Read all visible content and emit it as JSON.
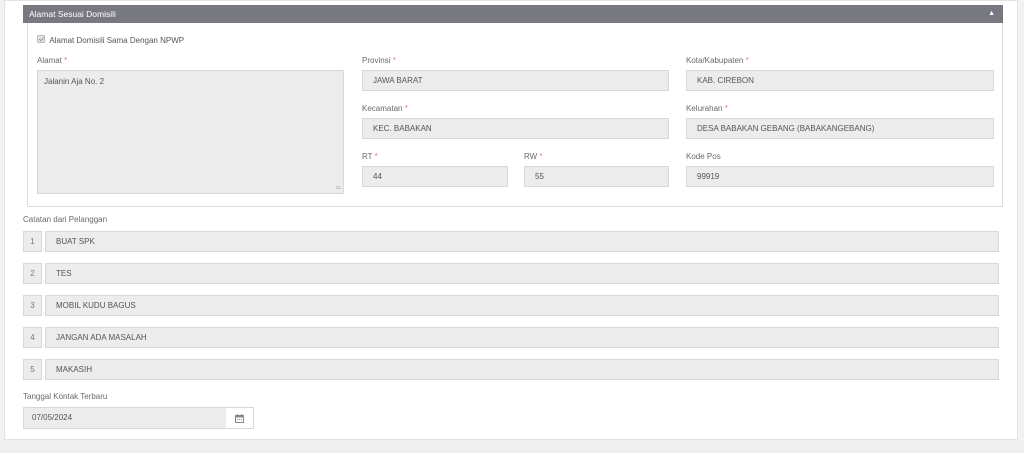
{
  "section": {
    "title": "Alamat Sesuai Domisili",
    "collapse_icon": "caret-up-icon",
    "same_as_npwp_label": "Alamat Domisili Sama Dengan NPWP",
    "same_as_npwp_checked": true
  },
  "address": {
    "alamat_label": "Alamat",
    "alamat_value": "Jalanin Aja No. 2",
    "provinsi_label": "Provinsi",
    "provinsi_value": "JAWA BARAT",
    "kota_label": "Kota/Kabupaten",
    "kota_value": "KAB. CIREBON",
    "kecamatan_label": "Kecamatan",
    "kecamatan_value": "KEC. BABAKAN",
    "kelurahan_label": "Kelurahan",
    "kelurahan_value": "DESA BABAKAN GEBANG (BABAKANGEBANG)",
    "rt_label": "RT",
    "rt_value": "44",
    "rw_label": "RW",
    "rw_value": "55",
    "kodepos_label": "Kode Pos",
    "kodepos_value": "99919",
    "required_mark": "*"
  },
  "notes": {
    "label": "Catatan dari Pelanggan",
    "items": [
      {
        "num": "1",
        "text": "BUAT SPK"
      },
      {
        "num": "2",
        "text": "TES"
      },
      {
        "num": "3",
        "text": "MOBIL KUDU BAGUS"
      },
      {
        "num": "4",
        "text": "JANGAN ADA MASALAH"
      },
      {
        "num": "5",
        "text": "MAKASIH"
      }
    ]
  },
  "contact": {
    "label": "Tanggal Kontak Terbaru",
    "date_value": "07/05/2024",
    "calendar_icon": "calendar-icon"
  }
}
